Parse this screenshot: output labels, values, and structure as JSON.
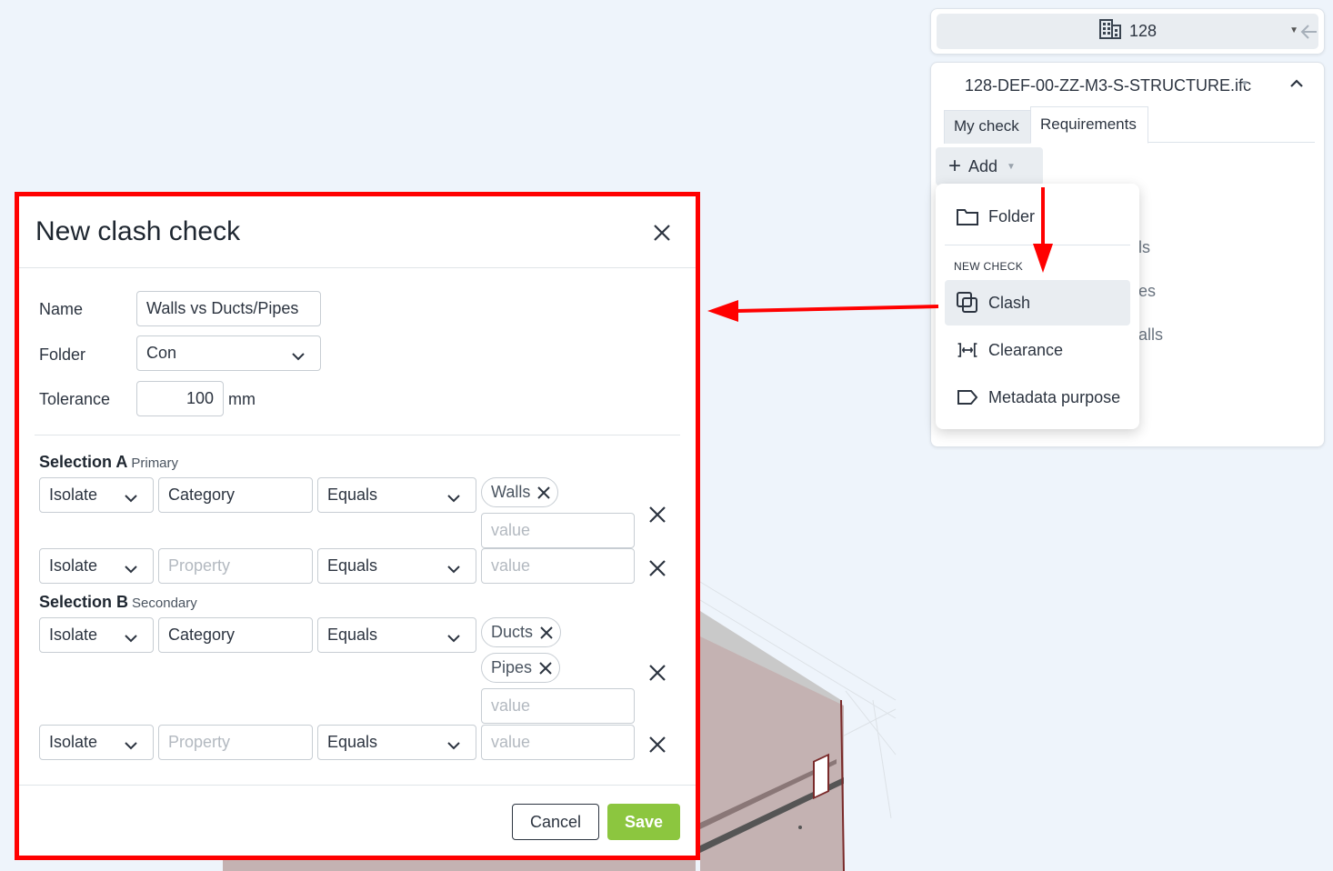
{
  "project": {
    "name": "128"
  },
  "model_panel": {
    "file_name": "128-DEF-00-ZZ-M3-S-STRUCTURE.ifc",
    "tabs": [
      {
        "label": "My check"
      },
      {
        "label": "Requirements"
      }
    ],
    "add_label": "Add",
    "hidden_items": [
      "ls",
      "es",
      "alls"
    ]
  },
  "add_menu": {
    "folder_label": "Folder",
    "section_label": "NEW CHECK",
    "items": [
      {
        "label": "Clash",
        "icon": "clash-icon",
        "active": true
      },
      {
        "label": "Clearance",
        "icon": "clearance-icon"
      },
      {
        "label": "Metadata purpose",
        "icon": "tag-icon"
      }
    ]
  },
  "dialog": {
    "title": "New clash check",
    "name_label": "Name",
    "name_value": "Walls vs Ducts/Pipes",
    "folder_label": "Folder",
    "folder_value": "Con",
    "tolerance_label": "Tolerance",
    "tolerance_value": "100",
    "tolerance_unit": "mm",
    "selection_a": {
      "title": "Selection A",
      "subtitle": "Primary",
      "rows": [
        {
          "mode": "Isolate",
          "property": "Category",
          "operator": "Equals",
          "chips": [
            "Walls"
          ],
          "value_placeholder": "value"
        },
        {
          "mode": "Isolate",
          "property_placeholder": "Property",
          "operator": "Equals",
          "value_placeholder": "value"
        }
      ]
    },
    "selection_b": {
      "title": "Selection B",
      "subtitle": "Secondary",
      "rows": [
        {
          "mode": "Isolate",
          "property": "Category",
          "operator": "Equals",
          "chips": [
            "Ducts",
            "Pipes"
          ],
          "value_placeholder": "value"
        },
        {
          "mode": "Isolate",
          "property_placeholder": "Property",
          "operator": "Equals",
          "value_placeholder": "value"
        }
      ]
    },
    "cancel_label": "Cancel",
    "save_label": "Save"
  },
  "colors": {
    "highlight": "#ff0000",
    "save": "#8cc63f",
    "background": "#eef4fb"
  }
}
